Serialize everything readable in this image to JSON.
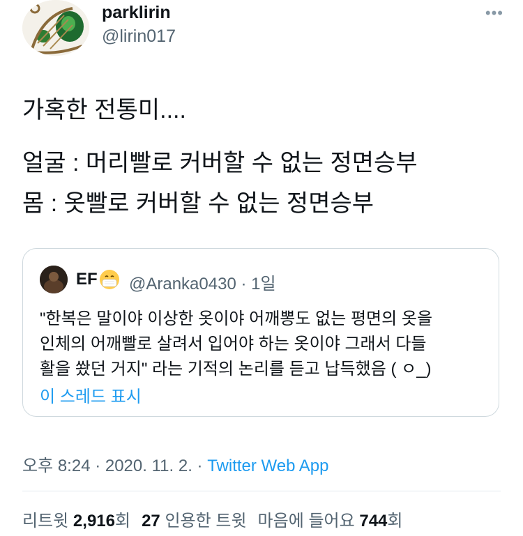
{
  "author": {
    "display_name": "parklirin",
    "handle": "@lirin017",
    "avatar_icon": "ornamental-harp-avatar"
  },
  "more_icon": "more-horizontal-icon",
  "tweet_lines": [
    "가혹한 전통미....",
    "얼굴 : 머리빨로 커버할 수 없는 정면승부",
    "몸 : 옷빨로 커버할 수 없는 정면승부"
  ],
  "quote": {
    "name": "EF",
    "emoji_icon": "face-with-medical-mask-icon",
    "handle_time": "@Aranka0430 · 1일",
    "lines": [
      "\"한복은 말이야 이상한 옷이야 어깨뽕도 없는 평면의 옷을",
      "인체의 어깨빨로 살려서 입어야 하는 옷이야 그래서 다들",
      "활을 쐈던 거지\" 라는 기적의 논리를 듣고 납득했음 ( ㅇ_)"
    ],
    "thread_link": "이 스레드 표시"
  },
  "meta": {
    "time": "오후 8:24 · 2020. 11. 2. · ",
    "app": "Twitter Web App"
  },
  "stats": {
    "retweets_label": "리트윗",
    "retweets_count": "2,916",
    "retweets_suffix": "회",
    "quotes_count": "27",
    "quotes_label": "인용한 트윗",
    "likes_label": "마음에 들어요",
    "likes_count": "744",
    "likes_suffix": "회"
  },
  "colors": {
    "link": "#1d9bf0",
    "secondary_text": "#536471",
    "border": "#cfd9de"
  }
}
